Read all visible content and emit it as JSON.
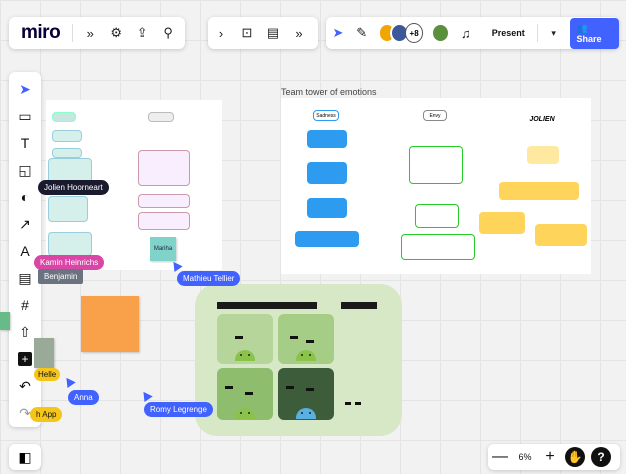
{
  "header": {
    "logo": "miro",
    "icons": [
      "chevron-down-icon",
      "gear-icon",
      "upload-icon",
      "search-icon"
    ]
  },
  "topbar": {
    "present_label": "Present",
    "share_label": "Share",
    "collaborators_more": "+8",
    "accent": "#4262ff"
  },
  "toolbar": {
    "tools": [
      "select",
      "frame",
      "text",
      "sticky-note",
      "shapes",
      "connection-line",
      "pen",
      "comment",
      "frame-grid",
      "upload",
      "add-more",
      "undo",
      "redo"
    ]
  },
  "canvas": {
    "frame1_title": "Team tower of emotions",
    "frame1_headings": [
      "Sadness",
      "Envy",
      "JOLIEN"
    ],
    "mini_sticky": "Mariha",
    "orange_sticky_text": "",
    "android_header_left": "",
    "android_header_right": "",
    "android_side_label": "",
    "left_board_headings": [
      "",
      ""
    ]
  },
  "cursors": [
    {
      "name": "Jolien Hoorneart",
      "color": "#1a1a2e"
    },
    {
      "name": "Kamin Heinrichs",
      "color": "#d946a6"
    },
    {
      "name": "Benjamin",
      "color": "#6b7280"
    },
    {
      "name": "Mathieu Tellier",
      "color": "#4262ff"
    },
    {
      "name": "Anna",
      "color": "#4262ff"
    },
    {
      "name": "Romy Legrenge",
      "color": "#4262ff"
    },
    {
      "name": "Helle",
      "color": "#f5c518"
    },
    {
      "name": "h App",
      "color": "#f5c518"
    }
  ],
  "zoom": {
    "level": "6%",
    "minus": "—",
    "plus": "+",
    "help": "?"
  }
}
